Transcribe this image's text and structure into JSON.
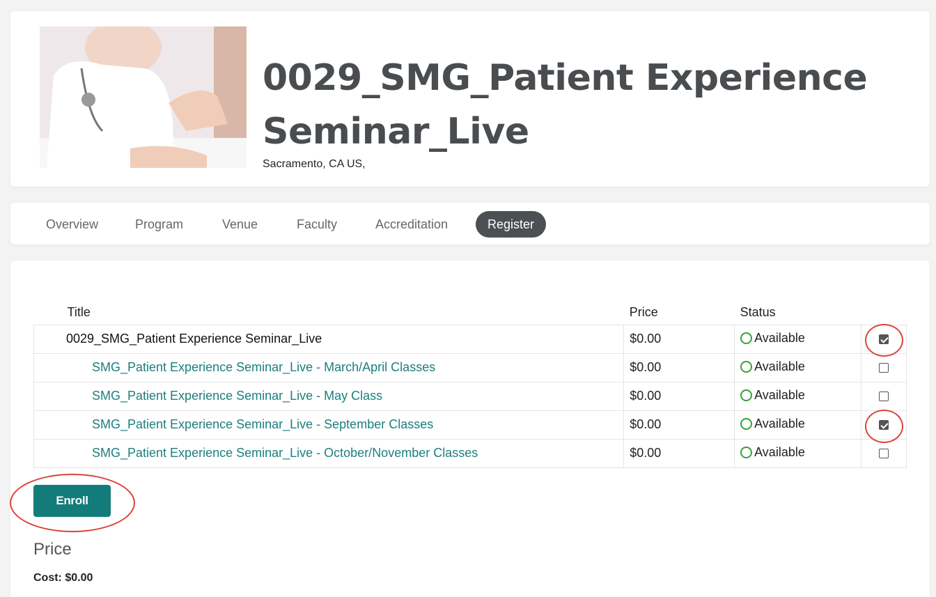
{
  "header": {
    "title": "0029_SMG_Patient Experience Seminar_Live",
    "location": "Sacramento, CA US,"
  },
  "tabs": [
    {
      "label": "Overview",
      "active": false
    },
    {
      "label": "Program",
      "active": false
    },
    {
      "label": "Venue",
      "active": false
    },
    {
      "label": "Faculty",
      "active": false
    },
    {
      "label": "Accreditation",
      "active": false
    },
    {
      "label": "Register",
      "active": true
    }
  ],
  "table": {
    "headers": {
      "title": "Title",
      "price": "Price",
      "status": "Status"
    },
    "rows": [
      {
        "title": "0029_SMG_Patient Experience Seminar_Live",
        "price": "$0.00",
        "status": "Available",
        "checked": true
      },
      {
        "title": "SMG_Patient Experience Seminar_Live - March/April Classes",
        "price": "$0.00",
        "status": "Available",
        "checked": false
      },
      {
        "title": "SMG_Patient Experience Seminar_Live - May Class",
        "price": "$0.00",
        "status": "Available",
        "checked": false
      },
      {
        "title": "SMG_Patient Experience Seminar_Live - September Classes",
        "price": "$0.00",
        "status": "Available",
        "checked": true
      },
      {
        "title": "SMG_Patient Experience Seminar_Live - October/November Classes",
        "price": "$0.00",
        "status": "Available",
        "checked": false
      }
    ]
  },
  "enroll_label": "Enroll",
  "price_section": {
    "heading": "Price",
    "cost": "Cost: $0.00"
  },
  "colors": {
    "accent": "#137c7a",
    "link": "#1b7f7d",
    "status_available": "#3aa03a",
    "annotation": "#d9443f"
  }
}
